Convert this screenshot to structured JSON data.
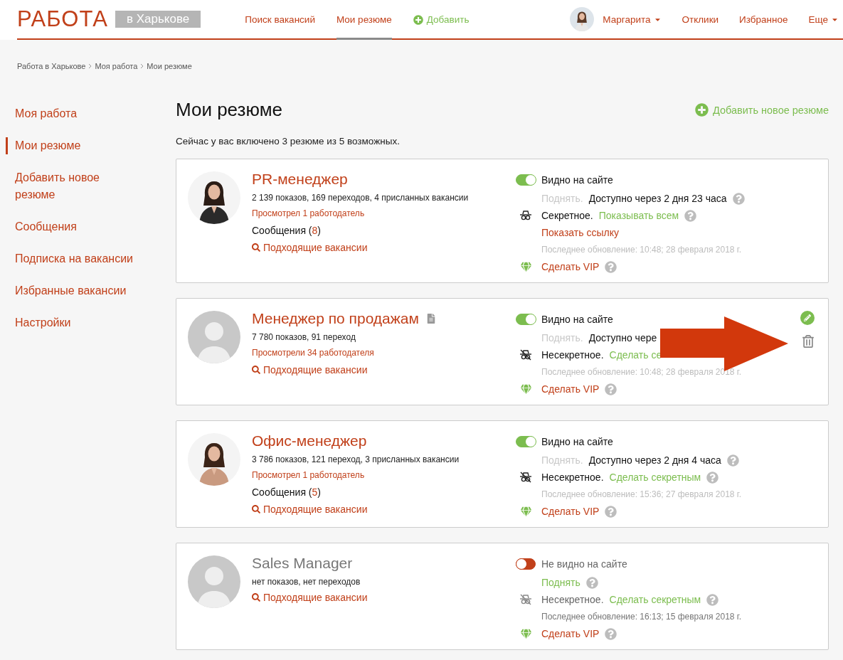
{
  "header": {
    "logo": "РАБОТА",
    "region": "в Харькове",
    "nav": [
      {
        "label": "Поиск вакансий",
        "selected": false,
        "kind": "link"
      },
      {
        "label": "Мои резюме",
        "selected": true,
        "kind": "link"
      },
      {
        "label": "Добавить",
        "selected": false,
        "kind": "add"
      }
    ],
    "user": {
      "name": "Маргарита"
    },
    "links": [
      {
        "label": "Отклики",
        "kind": "link"
      },
      {
        "label": "Избранное",
        "kind": "link"
      },
      {
        "label": "Еще",
        "kind": "dropdown"
      }
    ]
  },
  "breadcrumbs": [
    "Работа в Харькове",
    "Моя работа",
    "Мои резюме"
  ],
  "sidebar": {
    "items": [
      {
        "label": "Моя работа",
        "selected": false
      },
      {
        "label": "Мои резюме",
        "selected": true
      },
      {
        "label": "Добавить новое резюме",
        "selected": false
      },
      {
        "label": "Сообщения",
        "selected": false
      },
      {
        "label": "Подписка на вакансии",
        "selected": false
      },
      {
        "label": "Избранные вакансии",
        "selected": false
      },
      {
        "label": "Настройки",
        "selected": false
      }
    ]
  },
  "page": {
    "title": "Мои резюме",
    "add_button": "Добавить новое резюме",
    "summary": "Сейчас у вас включено 3 резюме из 5 возможных."
  },
  "resumes": [
    {
      "title": "PR-менеджер",
      "document": false,
      "stats": "2 139 показов, 169 переходов, 4 присланных вакансии",
      "viewed": "Просмотрел 1 работодатель",
      "messages": {
        "before": "Сообщения (",
        "count": "8",
        "after": ")"
      },
      "matching": "Подходящие вакансии",
      "visible": true,
      "visibility": "Видно на сайте",
      "raise": {
        "label": "Поднять.",
        "available": false,
        "note": "Доступно через 2 дня 23 часа",
        "help": true
      },
      "secret": true,
      "secrecy": "Секретное.",
      "secrecy_action": "Показывать всем",
      "secrecy_help": true,
      "show_link": "Показать ссылку",
      "updated": "Последнее обновление: 10:48; 28 февраля 2018 г.",
      "vip": "Сделать VIP",
      "actions": false,
      "annotated": false
    },
    {
      "title": "Менеджер по продажам",
      "avatar": {
        "kind": "placeholder"
      },
      "document": true,
      "stats": "7 780 показов, 91 переход",
      "viewed": "Просмотрели 34 работодателя",
      "matching": "Подходящие вакансии",
      "visible": true,
      "visibility": "Видно на сайте",
      "raise": {
        "label": "Поднять.",
        "available": false,
        "note": "Доступно чере",
        "help": false
      },
      "secret": false,
      "secrecy": "Несекретное.",
      "secrecy_action": "Сделать се",
      "secrecy_help": false,
      "updated": "Последнее обновление: 10:48; 28 февраля 2018 г.",
      "vip": "Сделать VIP",
      "actions": true,
      "annotated": true
    },
    {
      "title": "Офис-менеджер",
      "document": false,
      "stats": "3 786 показов, 121 переход, 3 присланных вакансии",
      "viewed": "Просмотрел 1 работодатель",
      "messages": {
        "before": "Сообщения (",
        "count": "5",
        "after": ")"
      },
      "matching": "Подходящие вакансии",
      "visible": true,
      "visibility": "Видно на сайте",
      "raise": {
        "label": "Поднять.",
        "available": false,
        "note": "Доступно через 2 дня 4 часа",
        "help": true
      },
      "secret": false,
      "secrecy": "Несекретное.",
      "secrecy_action": "Сделать секретным",
      "secrecy_help": true,
      "updated": "Последнее обновление: 15:36; 27 февраля 2018 г.",
      "vip": "Сделать VIP",
      "actions": false,
      "annotated": false
    },
    {
      "title": "Sales Manager",
      "avatar": {
        "kind": "placeholder"
      },
      "document": false,
      "stats": "нет показов, нет переходов",
      "matching": "Подходящие вакансии",
      "visible": false,
      "visibility": "Не видно на сайте",
      "raise": {
        "label": "Поднять",
        "available": true,
        "help": true
      },
      "secret": false,
      "secrecy": "Несекретное.",
      "secrecy_action": "Сделать секретным",
      "secrecy_help": true,
      "updated": "Последнее обновление: 16:13; 15 февраля 2018 г.",
      "vip": "Сделать VIP",
      "actions": false,
      "annotated": false
    }
  ]
}
